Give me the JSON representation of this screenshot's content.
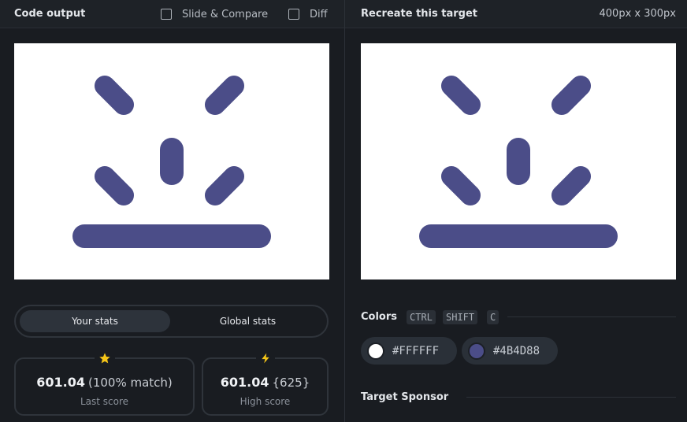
{
  "left_panel": {
    "title": "Code output",
    "slide_compare_label": "Slide & Compare",
    "diff_label": "Diff"
  },
  "right_panel": {
    "title": "Recreate this target",
    "size_label": "400px x 300px"
  },
  "stats": {
    "your_stats_label": "Your stats",
    "global_stats_label": "Global stats",
    "last_score": {
      "value": "601.04",
      "extra": "(100% match)",
      "label": "Last score",
      "icon": "star-icon"
    },
    "high_score": {
      "value": "601.04",
      "extra": "{625}",
      "label": "High score",
      "icon": "lightning-icon"
    }
  },
  "colors": {
    "title": "Colors",
    "shortcut_keys": [
      "CTRL",
      "SHIFT",
      "C"
    ],
    "swatches": [
      {
        "hex": "#FFFFFF"
      },
      {
        "hex": "#4B4D88"
      }
    ]
  },
  "sponsor": {
    "title": "Target Sponsor"
  },
  "palette": {
    "accent": "#4B4D88",
    "canvas_bg": "#FFFFFF",
    "star": "#f5c518"
  }
}
